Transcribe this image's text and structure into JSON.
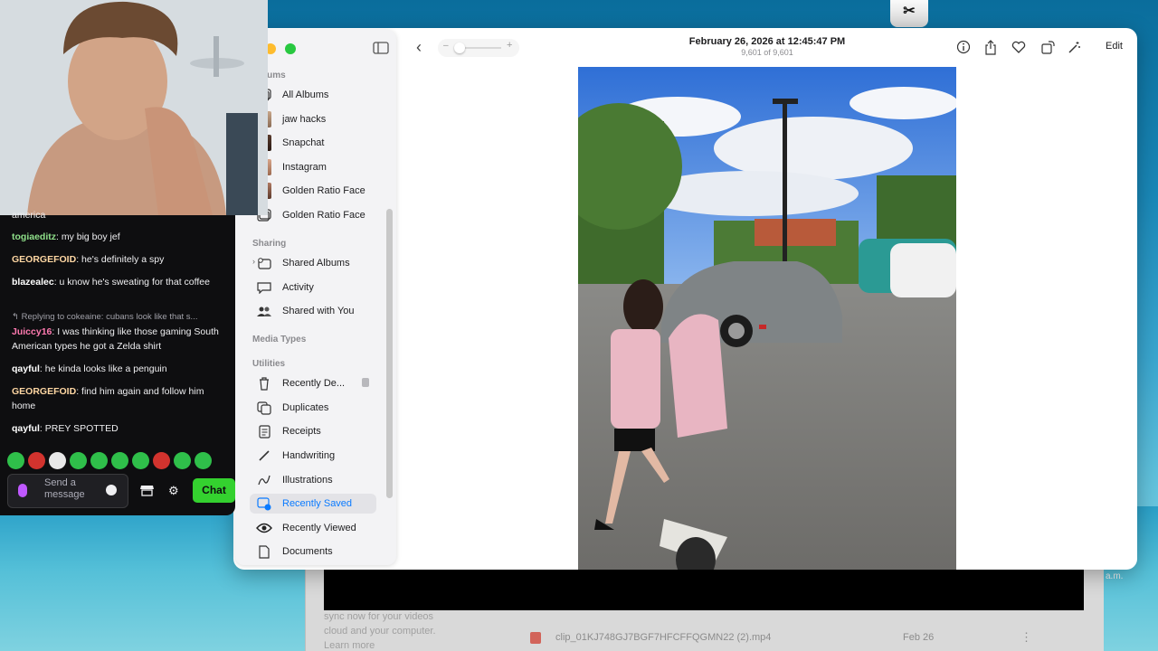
{
  "background": {
    "file_name": "clip_01KJ748GJ7BGF7HFCFFQGMN22 (2).mp4",
    "file_date": "Feb 26",
    "text_lines": [
      "sync now for your videos",
      "cloud and your computer.",
      "Learn more"
    ],
    "right_text": "a.m."
  },
  "photos": {
    "date": "February 26, 2026 at 12:45:47 PM",
    "count": "9,601 of 9,601",
    "edit_label": "Edit",
    "sidebar": {
      "section_albums": "Albums",
      "albums": [
        "All Albums",
        "jaw hacks",
        "Snapchat",
        "Instagram",
        "Golden Ratio Face",
        "Golden Ratio Face"
      ],
      "section_sharing": "Sharing",
      "sharing": [
        "Shared Albums",
        "Activity",
        "Shared with You"
      ],
      "section_media": "Media Types",
      "section_utilities": "Utilities",
      "utilities": [
        "Recently De...",
        "Duplicates",
        "Receipts",
        "Handwriting",
        "Illustrations",
        "Recently Saved",
        "Recently Viewed",
        "Documents"
      ]
    }
  },
  "chat": {
    "top_fragment": "america",
    "messages": [
      {
        "user": "togiaeditz",
        "color": "#8fe08a",
        "text": "my big boy jef"
      },
      {
        "user": "GEORGEFOID",
        "color": "#ffd7a3",
        "text": "he's definitely a spy"
      },
      {
        "user": "blazealec",
        "color": "#ffffff",
        "text": "u know he's sweating for that coffee"
      },
      {
        "user": "Juiccy16",
        "color": "#ff7ab0",
        "text": "I was thinking like those gaming South American types he got a Zelda shirt"
      },
      {
        "user": "qayful",
        "color": "#ffffff",
        "text": "he kinda looks like a penguin"
      },
      {
        "user": "GEORGEFOID",
        "color": "#ffd7a3",
        "text": "find him again and follow him home"
      },
      {
        "user": "qayful",
        "color": "#ffffff",
        "text": "PREY SPOTTED"
      }
    ],
    "reply_line": "Replying to cokeaine: cubans look like that s...",
    "input_placeholder": "Send a message",
    "chat_button": "Chat"
  }
}
